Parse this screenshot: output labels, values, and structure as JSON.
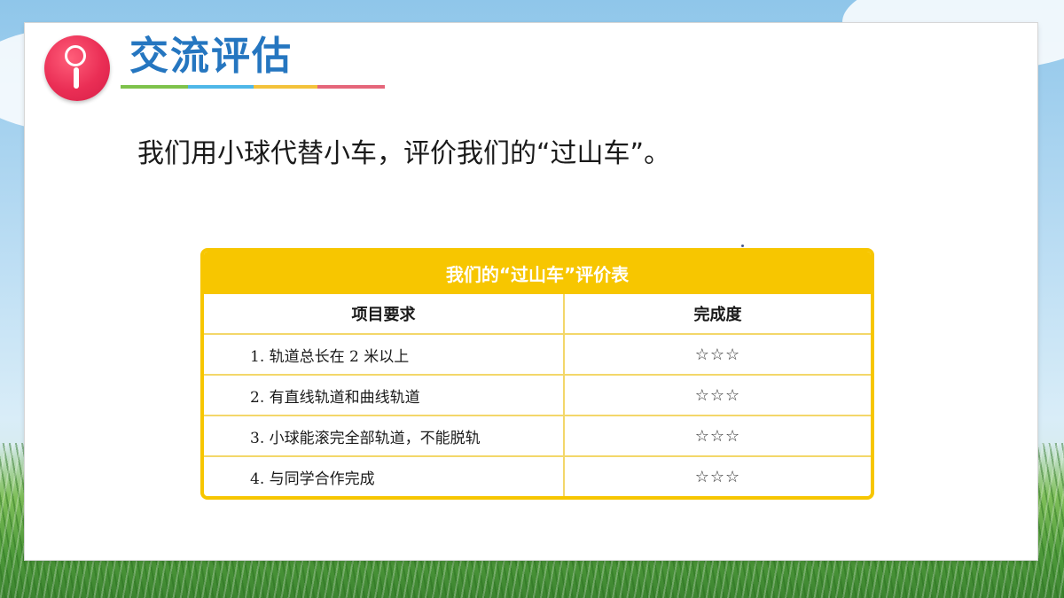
{
  "header": {
    "title": "交流评估",
    "badge_icon": "magnifier-icon",
    "underline_colors": [
      "#7ec24b",
      "#4fb7e8",
      "#f3c23b",
      "#e5667a"
    ],
    "accent_color": "#2576c0"
  },
  "intro_text": "我们用小球代替小车，评价我们的“过山车”。",
  "table": {
    "title": "我们的“过山车”评价表",
    "columns": [
      "项目要求",
      "完成度"
    ],
    "rows": [
      {
        "item": "1. 轨道总长在 2 米以上",
        "rating": "☆☆☆"
      },
      {
        "item": "2. 有直线轨道和曲线轨道",
        "rating": "☆☆☆"
      },
      {
        "item": "3. 小球能滚完全部轨道，不能脱轨",
        "rating": "☆☆☆"
      },
      {
        "item": "4. 与同学合作完成",
        "rating": "☆☆☆"
      }
    ],
    "border_color": "#f7c600"
  }
}
